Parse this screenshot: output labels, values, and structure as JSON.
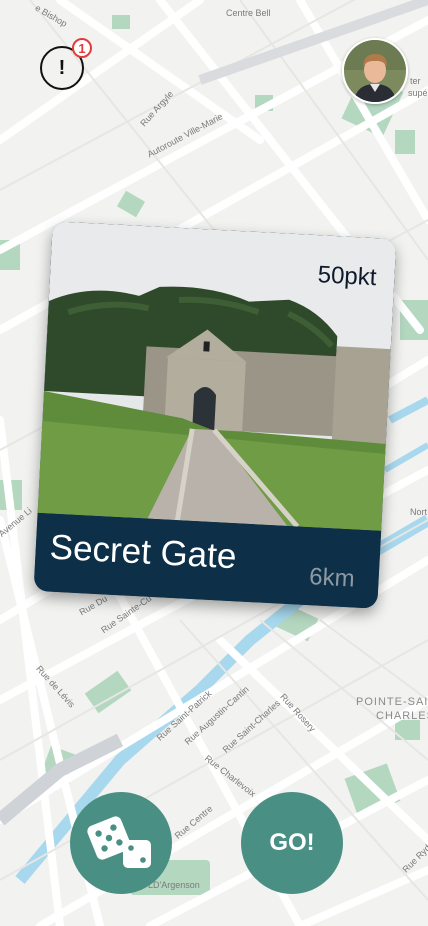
{
  "map": {
    "labels": [
      {
        "id": "bishop",
        "text": "e Bishop"
      },
      {
        "id": "centre-bell",
        "text": "Centre Bell"
      },
      {
        "id": "argyle",
        "text": "Rue Argyle"
      },
      {
        "id": "ville-marie",
        "text": "Autoroute Ville-Marie"
      },
      {
        "id": "avenue",
        "text": "Avenue Li"
      },
      {
        "id": "north",
        "text": "Nort"
      },
      {
        "id": "dupre",
        "text": "Rue Du"
      },
      {
        "id": "sainte-cu",
        "text": "Rue Sainte-Cu"
      },
      {
        "id": "levis",
        "text": "Rue de Lévis"
      },
      {
        "id": "saint-patrick",
        "text": "Rue Saint-Patrick"
      },
      {
        "id": "augustin",
        "text": "Rue Augustin-Cantin"
      },
      {
        "id": "saint-charles",
        "text": "Rue Saint-Charles"
      },
      {
        "id": "rosery",
        "text": "Rue Rosery"
      },
      {
        "id": "charlevoix",
        "text": "Rue Charlevoix"
      },
      {
        "id": "centre",
        "text": "Rue Centre"
      },
      {
        "id": "rue-ryde",
        "text": "Rue Ryde"
      },
      {
        "id": "argenson",
        "text": "LD'Argenson"
      },
      {
        "id": "pointe",
        "text": "POINTE-SAI"
      },
      {
        "id": "charles",
        "text": "CHARLES"
      },
      {
        "id": "ter",
        "text": "ter"
      },
      {
        "id": "supe",
        "text": "supé"
      }
    ]
  },
  "alert": {
    "icon": "alert-icon",
    "mark": "!",
    "count": "1"
  },
  "avatar": {
    "icon": "user-avatar"
  },
  "card": {
    "points": "50pkt",
    "title": "Secret Gate",
    "distance": "6km"
  },
  "actions": {
    "random_icon": "dice-icon",
    "go_label": "GO!"
  },
  "colors": {
    "accent": "#4a8f84",
    "card_footer": "#0d3048",
    "badge": "#e33b3b"
  }
}
